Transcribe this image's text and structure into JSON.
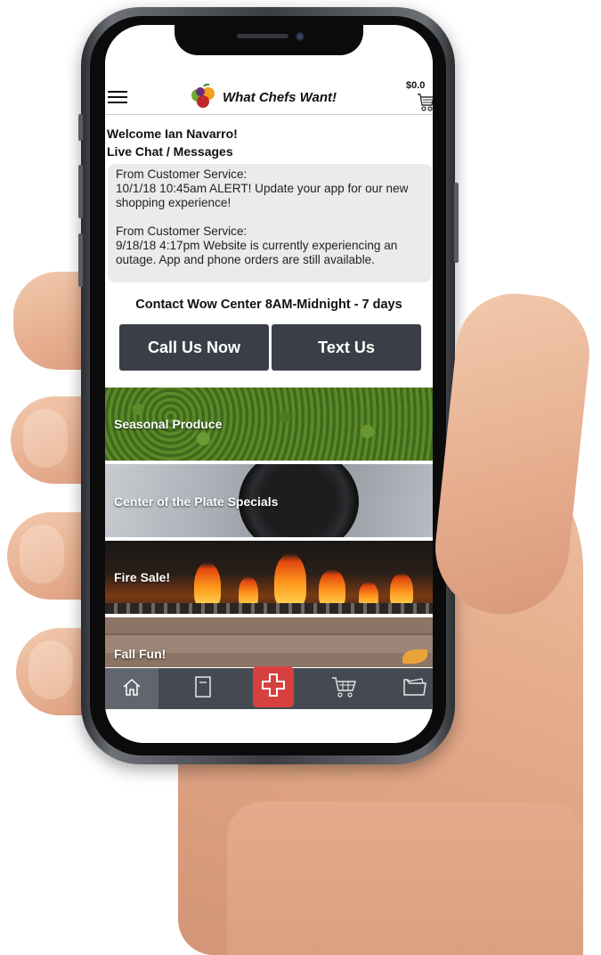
{
  "header": {
    "brand_name": "What Chefs Want!",
    "cart_total": "$0.0",
    "icons": [
      "menu-icon",
      "logo-icon",
      "cart-icon"
    ]
  },
  "welcome": {
    "greeting": "Welcome Ian Navarro!",
    "live_chat": "Live Chat / Messages"
  },
  "messages": [
    {
      "from": "From Customer Service:",
      "body": "10/1/18 10:45am ALERT! Update your app for our new shopping experience!"
    },
    {
      "from": "From Customer Service:",
      "body": "9/18/18 4:17pm Website is currently experiencing an outage.  App and phone orders are still available."
    }
  ],
  "contact": {
    "hours": "Contact Wow Center 8AM-Midnight - 7 days",
    "call_label": "Call Us Now",
    "text_label": "Text Us"
  },
  "categories": [
    {
      "label": "Seasonal Produce"
    },
    {
      "label": "Center of the Plate Specials"
    },
    {
      "label": "Fire Sale!"
    },
    {
      "label": "Fall Fun!"
    }
  ],
  "tabbar": {
    "icons": [
      "home-icon",
      "catalog-icon",
      "add-icon",
      "cart-icon",
      "folder-icon"
    ],
    "active": "home-icon"
  },
  "colors": {
    "button_bg": "#3a3f47",
    "tabbar_bg": "#454a52",
    "add_button": "#d6413f",
    "message_bg": "#ebebeb"
  }
}
